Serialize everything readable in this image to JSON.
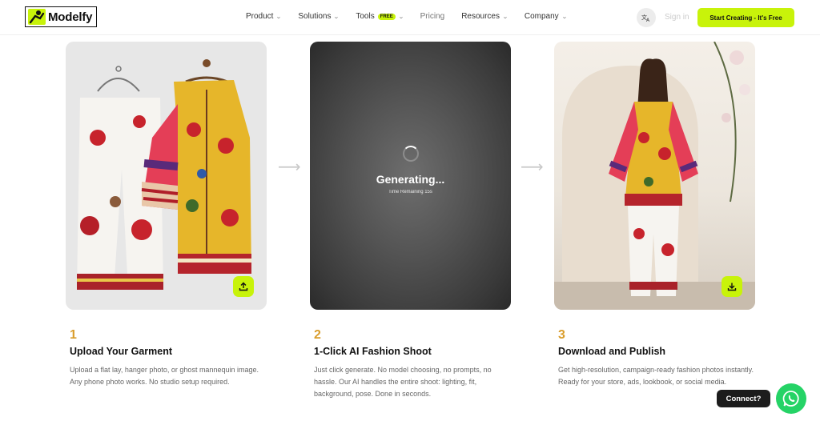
{
  "brand": {
    "name": "Modelfy",
    "accent": "#c8f30a"
  },
  "nav": {
    "items": [
      {
        "label": "Product",
        "has_menu": true
      },
      {
        "label": "Solutions",
        "has_menu": true
      },
      {
        "label": "Tools",
        "badge": "FREE",
        "has_menu": true
      },
      {
        "label": "Pricing",
        "has_menu": false
      },
      {
        "label": "Resources",
        "has_menu": true
      },
      {
        "label": "Company",
        "has_menu": true
      }
    ],
    "language_icon": "translate-icon",
    "sign_in": "Sign in",
    "cta": "Start Creating - It's Free"
  },
  "cards": {
    "upload_icon": "upload-icon",
    "download_icon": "download-icon",
    "generating": {
      "title": "Generating...",
      "subtitle": "Time Remaining 15s"
    }
  },
  "steps": [
    {
      "number": "1",
      "title": "Upload Your Garment",
      "description": "Upload a flat lay, hanger photo, or ghost mannequin image. Any phone photo works. No studio setup required."
    },
    {
      "number": "2",
      "title": "1-Click AI Fashion Shoot",
      "description": "Just click generate. No model choosing, no prompts, no hassle. Our AI handles the entire shoot: lighting, fit, background, pose. Done in seconds."
    },
    {
      "number": "3",
      "title": "Download and Publish",
      "description": "Get high-resolution, campaign-ready fashion photos instantly. Ready for your store, ads, lookbook, or social media."
    }
  ],
  "chat": {
    "label": "Connect?",
    "icon": "whatsapp-icon"
  }
}
